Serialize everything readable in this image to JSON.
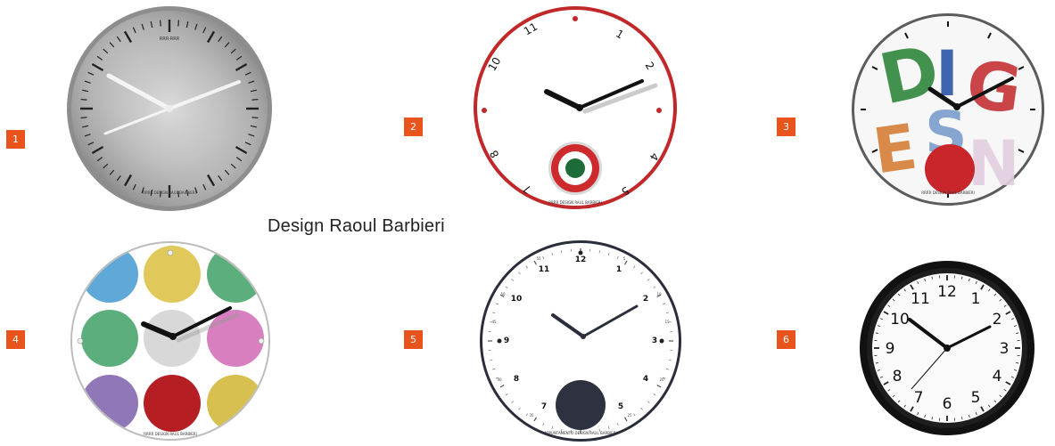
{
  "caption": "Design Raoul Barbieri",
  "badges": [
    "1",
    "2",
    "3",
    "4",
    "5",
    "6"
  ],
  "colors": {
    "badge": "#e8541c",
    "clock2_rim": "#c0282a",
    "clock3_dial_red": "#c8262a",
    "clock6_rim": "#111111"
  },
  "clocks": [
    {
      "id": 1,
      "style": "brushed-steel",
      "brand": "RRR-RRR",
      "footer": "RRRR DESIGN RAUL BARBIERI"
    },
    {
      "id": 2,
      "style": "red-rim-target-pendulum",
      "numerals": [
        "11",
        "1",
        "10",
        "2",
        "8",
        "4",
        "7",
        "5"
      ],
      "footer": "RRRR DESIGN RAUL BARBIERI"
    },
    {
      "id": 3,
      "style": "design-letters",
      "letters": [
        "D",
        "I",
        "G",
        "E",
        "S",
        "N"
      ],
      "footer": "RRRR DESIGN RAUL BARBIERI"
    },
    {
      "id": 4,
      "style": "colored-dots",
      "footer": "RRRR DESIGN RAUL BARBIERI"
    },
    {
      "id": 5,
      "style": "appointment-timer",
      "numerals": [
        "12",
        "11",
        "1",
        "10",
        "2",
        "9",
        "3",
        "8",
        "4",
        "7",
        "5"
      ],
      "minute_marks": [
        "55",
        "5",
        "50",
        "10",
        "45",
        "15",
        "40",
        "20",
        "35",
        "25"
      ],
      "footer": "APPUNTAMENTO DESIGN RAUL BARBIERI"
    },
    {
      "id": 6,
      "style": "black-frame",
      "numerals": [
        "12",
        "1",
        "2",
        "3",
        "4",
        "5",
        "6",
        "7",
        "8",
        "9",
        "10",
        "11"
      ]
    }
  ]
}
